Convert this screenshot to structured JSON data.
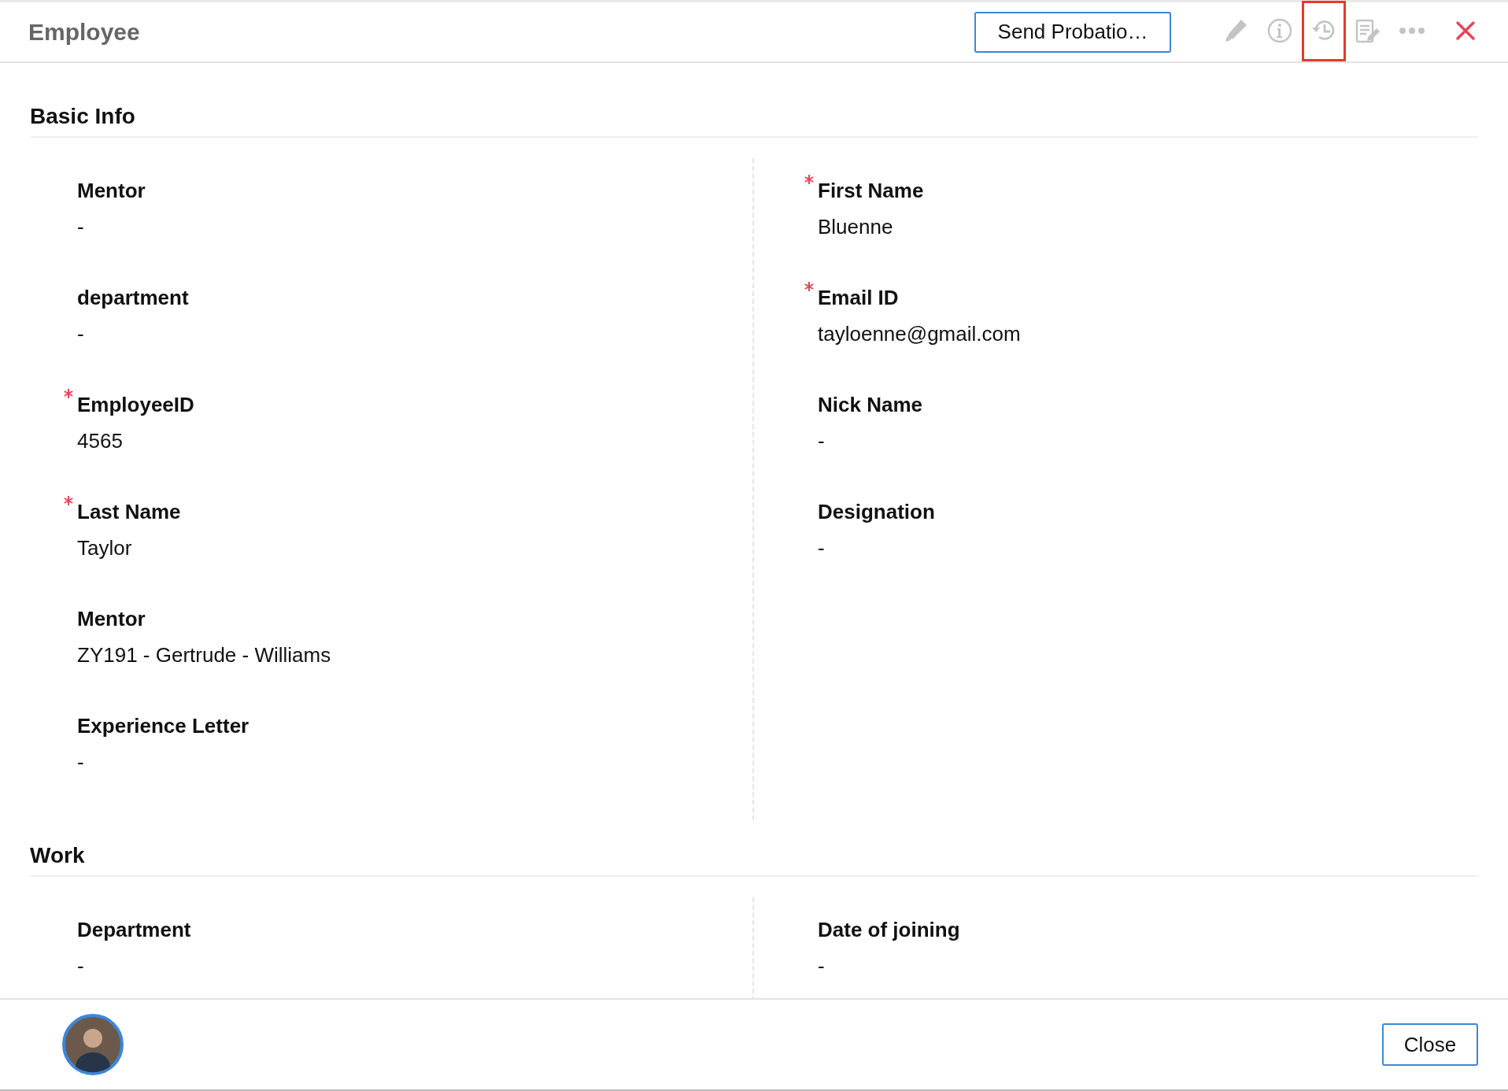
{
  "header": {
    "title": "Employee",
    "action_button": "Send Probatio…",
    "toolbar": [
      {
        "kind": "edit",
        "highlighted": false
      },
      {
        "kind": "info",
        "highlighted": false
      },
      {
        "kind": "history",
        "highlighted": true
      },
      {
        "kind": "notes",
        "highlighted": false
      },
      {
        "kind": "more",
        "highlighted": false
      },
      {
        "kind": "close",
        "highlighted": false
      }
    ]
  },
  "sections": [
    {
      "title": "Basic Info",
      "left": [
        {
          "label": "Mentor",
          "value": "-",
          "required": false
        },
        {
          "label": "department",
          "value": "-",
          "required": false
        },
        {
          "label": "EmployeeID",
          "value": "4565",
          "required": true
        },
        {
          "label": "Last Name",
          "value": "Taylor",
          "required": true
        },
        {
          "label": "Mentor",
          "value": "ZY191 - Gertrude - Williams",
          "required": false
        },
        {
          "label": "Experience Letter",
          "value": "-",
          "required": false
        }
      ],
      "right": [
        {
          "label": "First Name",
          "value": "Bluenne",
          "required": true
        },
        {
          "label": "Email ID",
          "value": "tayloenne@gmail.com",
          "required": true
        },
        {
          "label": "Nick Name",
          "value": "-",
          "required": false
        },
        {
          "label": "Designation",
          "value": "-",
          "required": false
        }
      ]
    },
    {
      "title": "Work",
      "left": [
        {
          "label": "Department",
          "value": "-",
          "required": false
        }
      ],
      "right": [
        {
          "label": "Date of joining",
          "value": "-",
          "required": false
        }
      ]
    }
  ],
  "footer": {
    "close_button": "Close"
  }
}
